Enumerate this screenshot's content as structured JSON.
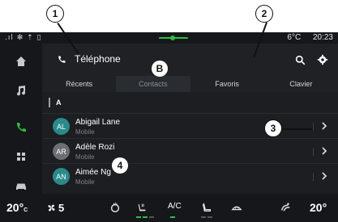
{
  "status_bar": {
    "left_icons": ".ıl ✻ ⇡ ▯",
    "temperature": "6°C",
    "time": "20:23"
  },
  "header": {
    "title": "Téléphone",
    "phone_icon": "phone-icon",
    "search_icon": "search-icon",
    "settings_icon": "gear-icon"
  },
  "tabs": [
    {
      "label": "Récents"
    },
    {
      "label": "Contacts"
    },
    {
      "label": "Favoris"
    },
    {
      "label": "Clavier"
    }
  ],
  "active_tab": "Contacts",
  "section_letter": "A",
  "contacts": [
    {
      "initials": "AL",
      "name": "Abigail Lane",
      "type": "Mobile",
      "avatar_color": "#2a8a8a"
    },
    {
      "initials": "AR",
      "name": "Adèle Rozi",
      "type": "Mobile",
      "avatar_color": "#6b6e73"
    },
    {
      "initials": "AN",
      "name": "Aimée Ng",
      "type": "Mobile",
      "avatar_color": "#2a8a8a"
    }
  ],
  "side_nav": [
    {
      "icon": "home-icon"
    },
    {
      "icon": "music-icon"
    },
    {
      "icon": "phone-icon",
      "active": true
    },
    {
      "icon": "apps-grid-icon"
    },
    {
      "icon": "car-icon"
    }
  ],
  "climate": {
    "left_temp": "20°",
    "left_temp_unit": "C",
    "fan_speed": "5",
    "ac_label": "A/C",
    "right_temp": "20°"
  },
  "callouts": [
    "1",
    "2",
    "B",
    "3",
    "4"
  ],
  "colors": {
    "accent": "#2fbf3e",
    "background": "#1c1e22",
    "avatar_teal": "#2a8a8a",
    "avatar_gray": "#6b6e73"
  }
}
